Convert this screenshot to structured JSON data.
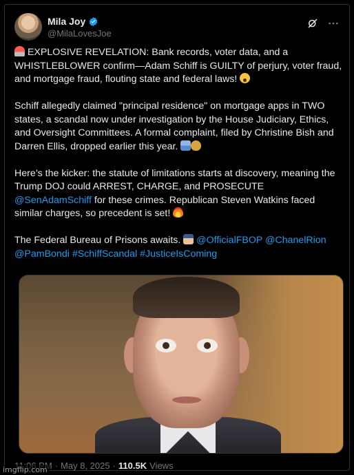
{
  "author": {
    "display_name": "Mila Joy",
    "handle": "@MilaLovesJoe",
    "verified": true
  },
  "header_icons": [
    "grok-icon",
    "more-icon"
  ],
  "post": {
    "p1": {
      "text": "EXPLOSIVE REVELATION: Bank records, voter data, and a WHISTLEBLOWER confirm—Adam Schiff is GUILTY of perjury, voter fraud, and mortgage fraud, flouting state and federal laws!"
    },
    "p2": {
      "text": "Schiff allegedly claimed \"principal residence\" on mortgage apps in TWO states, a scandal now under investigation by the House Judiciary, Ethics, and Oversight Committees. A formal complaint, filed by Christine Bish and Darren Ellis, dropped earlier this year."
    },
    "p3": {
      "text_before": "Here’s the kicker: the statute of limitations starts at discovery, meaning the Trump DOJ could ARREST, CHARGE, and PROSECUTE",
      "mention": "@SenAdamSchiff",
      "text_after": "for these crimes. Republican Steven Watkins faced similar charges, so precedent is set!"
    },
    "p4": {
      "text": "The Federal Bureau of Prisons awaits.",
      "links": [
        "@OfficialFBOP",
        "@ChanelRion",
        "@PamBondi",
        "#SchiffScandal",
        "#JusticeIsComing"
      ]
    }
  },
  "meta": {
    "time": "11:06 PM",
    "separator": "·",
    "date": "May 8, 2025",
    "views_count": "110.5K",
    "views_label": "Views"
  },
  "watermark": "imgflip.com"
}
